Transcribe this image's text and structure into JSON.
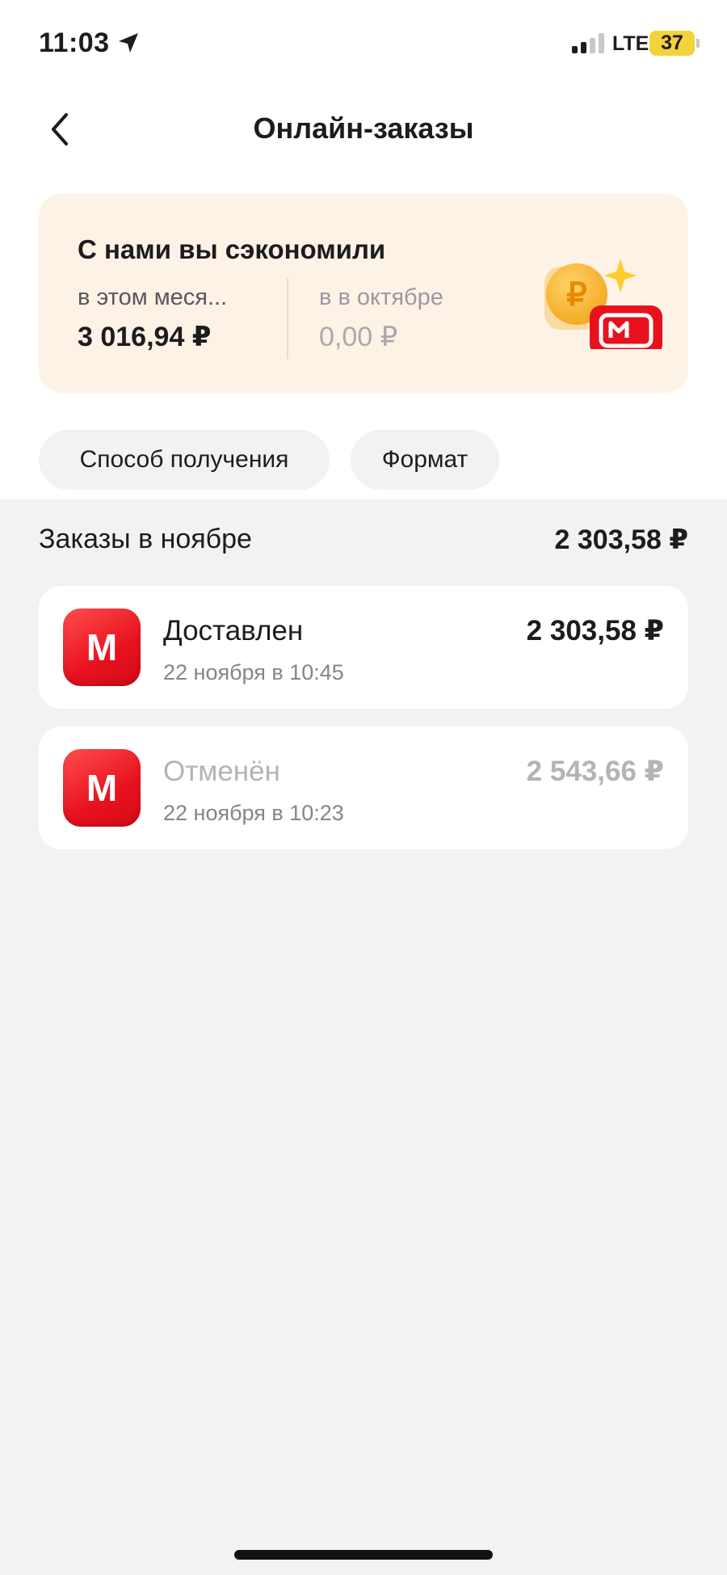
{
  "status_bar": {
    "time": "11:03",
    "network": "LTE",
    "battery": "37"
  },
  "header": {
    "title": "Онлайн-заказы"
  },
  "savings": {
    "title": "С нами вы сэкономили",
    "current_label": "в этом меся...",
    "current_value": "3 016,94 ₽",
    "previous_label": "в в октябре",
    "previous_value": "0,00 ₽"
  },
  "filters": {
    "delivery_method": "Способ получения",
    "format": "Формат"
  },
  "section": {
    "title": "Заказы в ноябре",
    "total": "2 303,58 ₽"
  },
  "orders": [
    {
      "status": "Доставлен",
      "date": "22 ноября в 10:45",
      "amount": "2 303,58 ₽",
      "logo_letter": "M"
    },
    {
      "status": "Отменён",
      "date": "22 ноября в 10:23",
      "amount": "2 543,66 ₽",
      "logo_letter": "M"
    }
  ],
  "colors": {
    "brand_red": "#e8121f",
    "card_cream": "#fdf2e6",
    "background": "#f2f2f2",
    "battery_yellow": "#f5d23a"
  },
  "icons": {
    "back": "chevron-left-icon",
    "location": "location-arrow-icon",
    "signal": "cellular-signal-icon",
    "battery": "battery-icon",
    "savings": "ruble-coin-icon"
  }
}
